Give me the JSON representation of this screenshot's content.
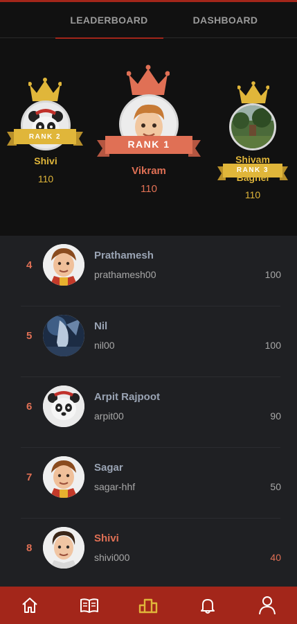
{
  "tabs": [
    {
      "label": "LEADERBOARD",
      "active": true
    },
    {
      "label": "DASHBOARD",
      "active": false
    }
  ],
  "podium": [
    {
      "position": "left",
      "rank_label": "RANK 2",
      "name": "Shivi",
      "score": "110",
      "avatar": "panda-avatar",
      "accent": "#e0b63a"
    },
    {
      "position": "center",
      "rank_label": "RANK 1",
      "name": "Vikram",
      "score": "110",
      "avatar": "boy-avatar",
      "accent": "#e07055"
    },
    {
      "position": "right",
      "rank_label": "RANK 3",
      "name_line1": "Shivam",
      "name_line2": "Baghel",
      "score": "110",
      "avatar": "nature-photo",
      "accent": "#e0b63a"
    }
  ],
  "list": [
    {
      "rank": "4",
      "name": "Prathamesh",
      "username": "prathamesh00",
      "score": "100",
      "avatar": "cartoon-boy-avatar"
    },
    {
      "rank": "5",
      "name": "Nil",
      "username": "nil00",
      "score": "100",
      "avatar": "anime-photo"
    },
    {
      "rank": "6",
      "name": "Arpit Rajpoot",
      "username": "arpit00",
      "score": "90",
      "avatar": "panda-avatar"
    },
    {
      "rank": "7",
      "name": "Sagar",
      "username": "sagar-hhf",
      "score": "50",
      "avatar": "cartoon-boy-avatar"
    },
    {
      "rank": "8",
      "name": "Shivi",
      "username": "shivi000",
      "score": "40",
      "avatar": "cartoon-boy-avatar",
      "highlight": true
    }
  ],
  "nav": [
    "home-icon",
    "book-icon",
    "leaderboard-icon",
    "bell-icon",
    "user-icon"
  ],
  "colors": {
    "accent_red": "#a3261a",
    "gold": "#e0b63a",
    "salmon": "#e07055",
    "nav_active": "#e0b63a"
  }
}
